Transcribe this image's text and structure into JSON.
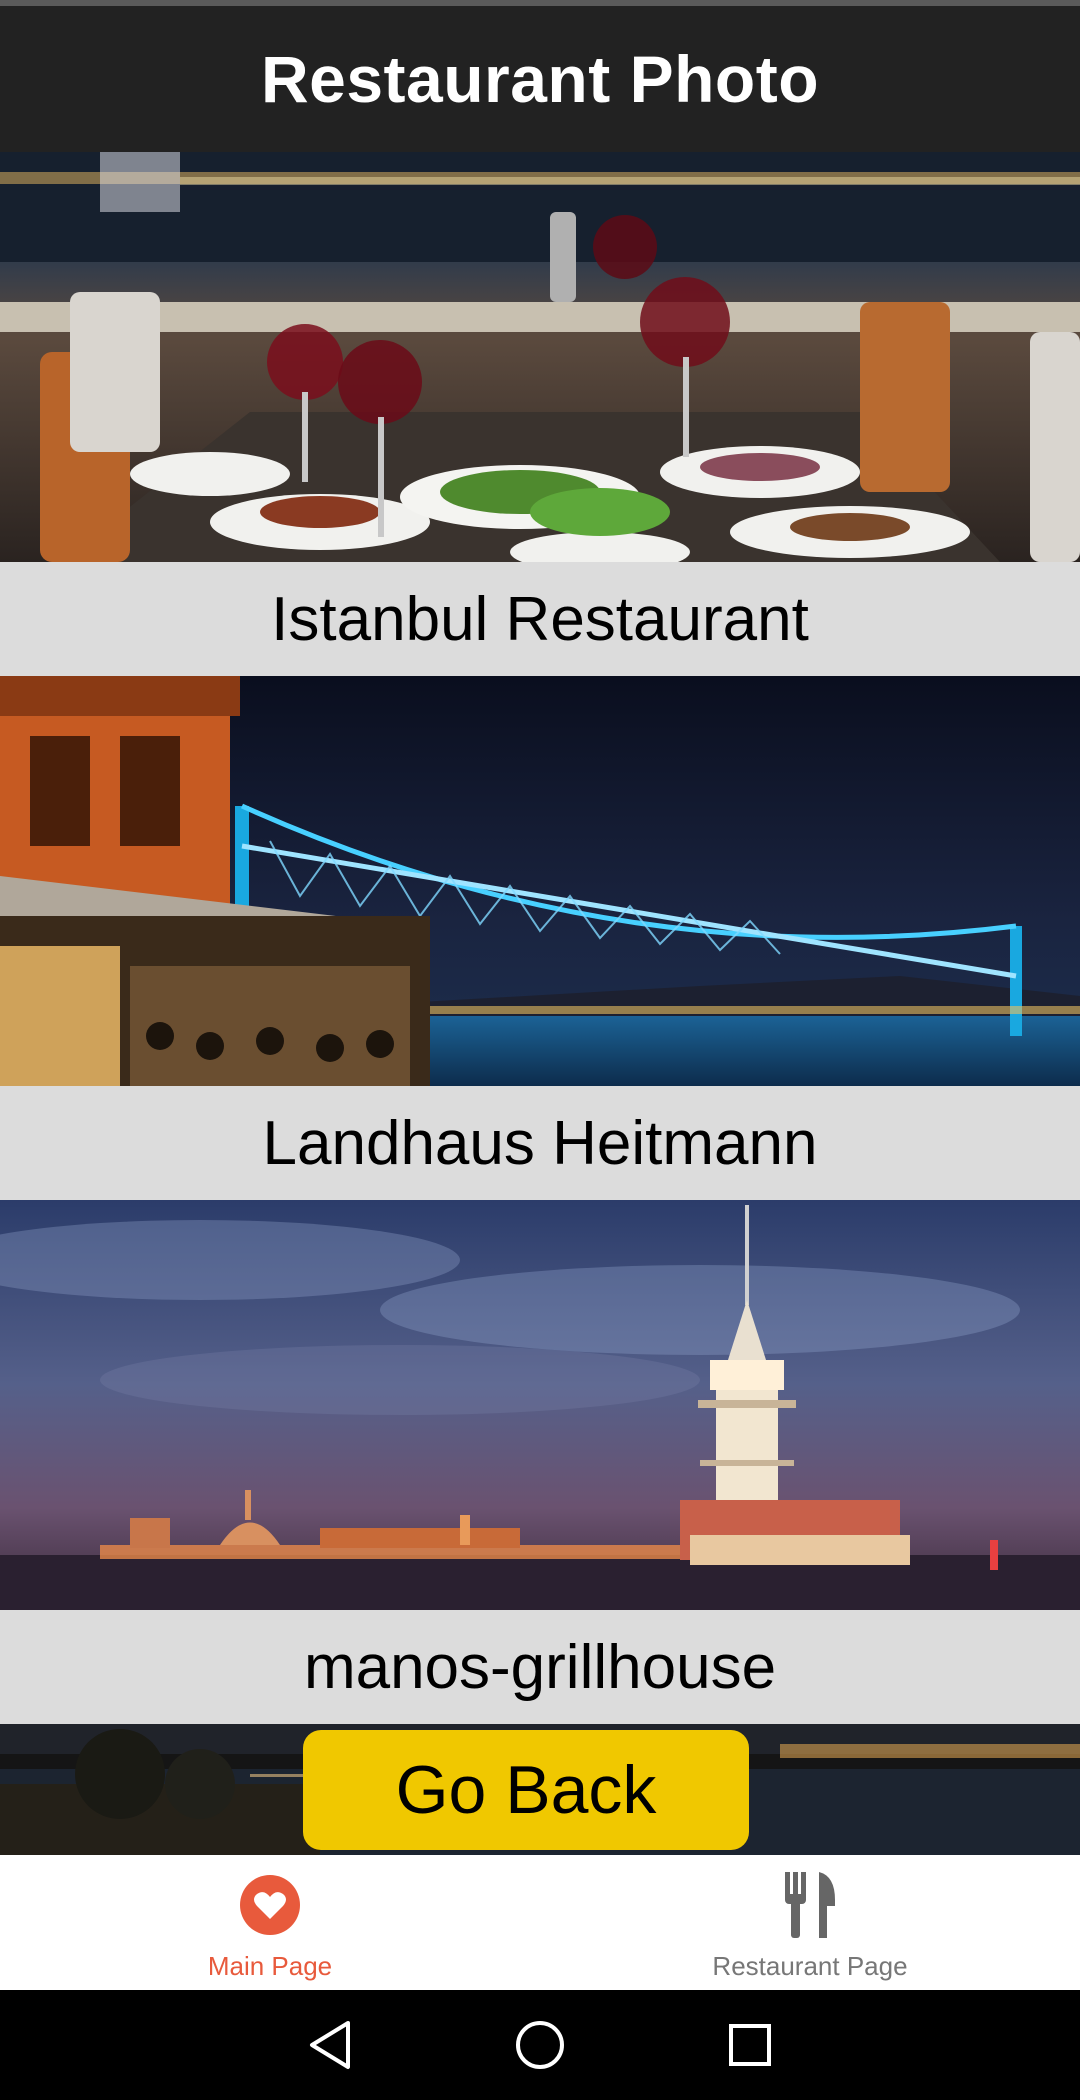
{
  "header": {
    "title": "Restaurant Photo"
  },
  "restaurants": [
    {
      "name": "Istanbul Restaurant",
      "photo": "dinner-table-night-photo"
    },
    {
      "name": "Landhaus Heitmann",
      "photo": "bosphorus-bridge-night-photo"
    },
    {
      "name": "manos-grillhouse",
      "photo": "maidens-tower-night-photo"
    }
  ],
  "partial_photo": "istanbul-shore-night-photo",
  "go_back": {
    "label": "Go Back"
  },
  "tabbar": {
    "tabs": [
      {
        "label": "Main Page",
        "icon": "heart-icon",
        "active": true
      },
      {
        "label": "Restaurant Page",
        "icon": "fork-knife-icon",
        "active": false
      }
    ]
  },
  "colors": {
    "header_bg": "#222222",
    "caption_bg": "#dcdcdc",
    "button_bg": "#f0c800",
    "active_tab": "#e85a3c",
    "inactive_tab": "#777777"
  },
  "system_nav": [
    "back-icon",
    "home-icon",
    "recents-icon"
  ]
}
